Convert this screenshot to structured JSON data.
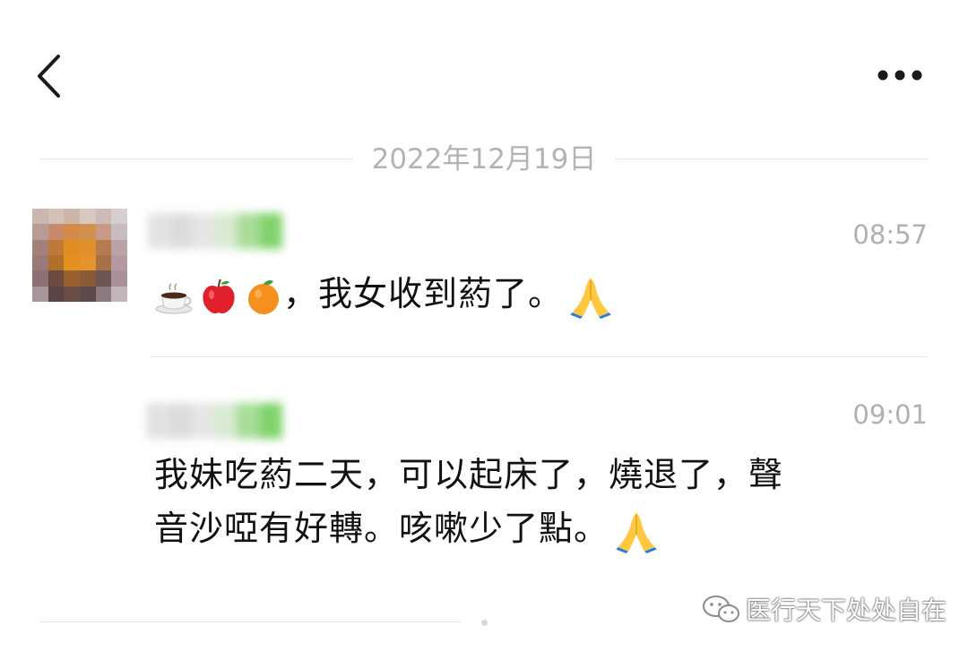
{
  "header": {
    "back_icon": "chevron-left-icon",
    "more_icon": "more-dots-icon"
  },
  "date_divider": "2022年12月19日",
  "messages": [
    {
      "time": "08:57",
      "emojis": [
        "coffee-emoji",
        "apple-emoji",
        "orange-emoji"
      ],
      "text": "，我女收到葯了。",
      "trailing_emoji": "praying-hands-emoji"
    },
    {
      "time": "09:01",
      "line1": "我妹吃葯二天，可以起床了，燒退了，聲",
      "line2": "音沙啞有好轉。咳嗽少了點。",
      "trailing_emoji": "praying-hands-emoji"
    }
  ],
  "watermark": {
    "icon": "wechat-icon",
    "text": "医行天下处处自在"
  },
  "colors": {
    "background": "#ffffff",
    "muted_text": "#b3b3b3",
    "divider": "#e6e6e6",
    "name_blur_green": "#7fd36b"
  }
}
